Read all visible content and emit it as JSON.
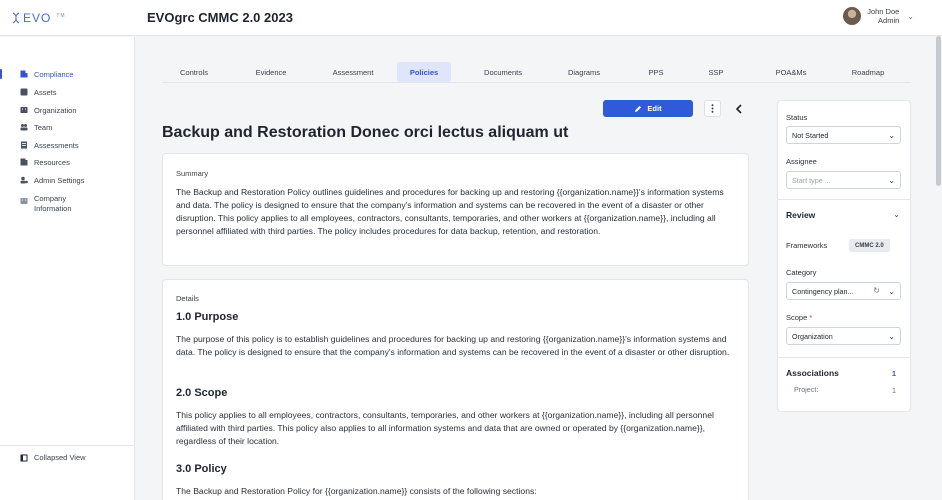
{
  "header": {
    "logo_text": "EVO",
    "logo_tm": "TM",
    "title": "EVOgrc CMMC 2.0 2023",
    "user_name": "John Doe",
    "user_role": "Admin"
  },
  "sidebar": {
    "items": [
      {
        "label": "Compliance",
        "icon": "compliance-icon"
      },
      {
        "label": "Assets",
        "icon": "assets-icon"
      },
      {
        "label": "Organization",
        "icon": "organization-icon"
      },
      {
        "label": "Team",
        "icon": "team-icon"
      },
      {
        "label": "Assessments",
        "icon": "assessments-icon"
      },
      {
        "label": "Resources",
        "icon": "resources-icon"
      },
      {
        "label": "Admin Settings",
        "icon": "admin-settings-icon"
      },
      {
        "label_line1": "Company",
        "label_line2": "Information",
        "icon": "company-information-icon"
      }
    ],
    "collapsed_label": "Collapsed View"
  },
  "tabs": [
    "Controls",
    "Evidence",
    "Assessment",
    "Policies",
    "Documents",
    "Diagrams",
    "PPS",
    "SSP",
    "POA&Ms",
    "Roadmap"
  ],
  "active_tab": "Policies",
  "toolbar": {
    "edit_label": "Edit"
  },
  "page_title": "Backup and Restoration Donec orci lectus aliquam ut",
  "summary": {
    "label": "Summary",
    "text": "The Backup and Restoration Policy outlines guidelines and procedures for backing up and restoring {{organization.name}}'s information systems and data. The policy is designed to ensure that the company's information and systems can be recovered in the event of a disaster or other disruption. This policy applies to all employees, contractors, consultants, temporaries, and other workers at {{organization.name}}, including all personnel affiliated with third parties. The policy includes procedures for data backup, retention, and restoration."
  },
  "details": {
    "label": "Details",
    "sections": [
      {
        "heading": "1.0 Purpose",
        "text": "The purpose of this policy is to establish guidelines and procedures for backing up and restoring {{organization.name}}'s information systems and data. The policy is designed to ensure that the company's information and systems can be recovered in the event of a disaster or other disruption."
      },
      {
        "heading": "2.0 Scope",
        "text": "This policy applies to all employees, contractors, consultants, temporaries, and other workers at {{organization.name}}, including all personnel affiliated with third parties. This policy also applies to all information systems and data that are owned or operated by {{organization.name}}, regardless of their location."
      },
      {
        "heading": "3.0 Policy",
        "text": "The Backup and Restoration Policy for {{organization.name}} consists of the following sections:"
      }
    ]
  },
  "right_panel": {
    "status_label": "Status",
    "status_value": "Not Started",
    "assignee_label": "Assignee",
    "assignee_placeholder": "Start type ...",
    "review_label": "Review",
    "frameworks_label": "Frameworks",
    "frameworks_badge": "CMMC 2.0",
    "category_label": "Category",
    "category_value": "Contingency plan...",
    "scope_label": "Scope",
    "scope_required": "*",
    "scope_value": "Organization",
    "associations_label": "Associations",
    "associations_count": "1",
    "project_label": "Project:",
    "project_count": "1"
  },
  "colors": {
    "accent": "#2f5bd8",
    "active_tab_bg": "#dfe6fb",
    "required": "#d23a3a"
  }
}
